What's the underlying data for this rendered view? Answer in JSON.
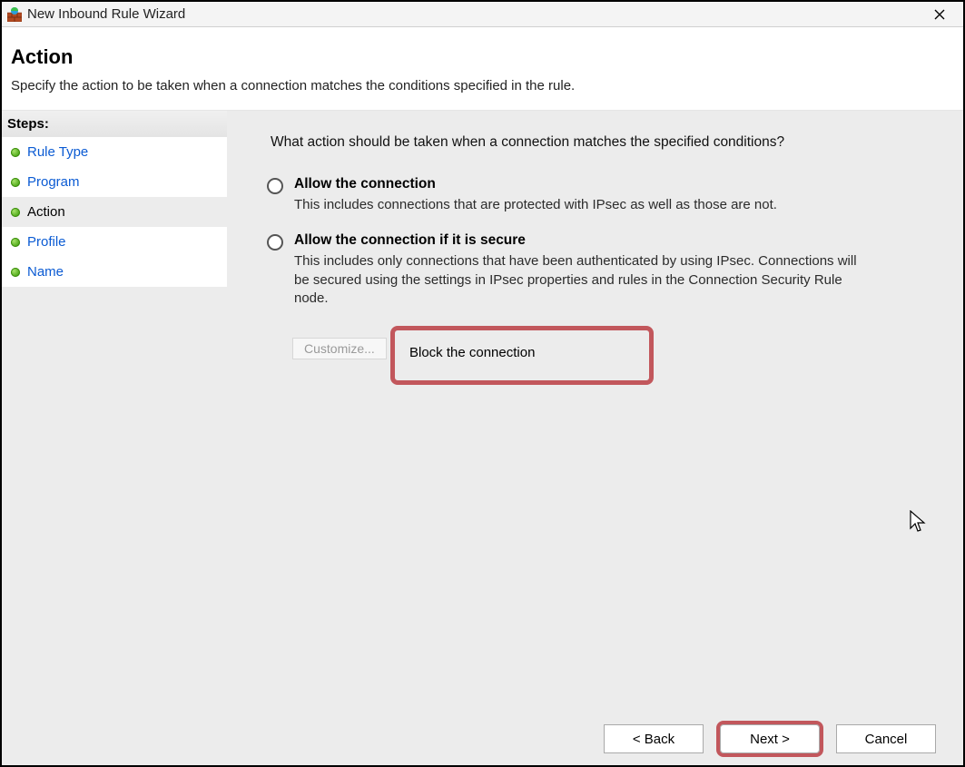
{
  "window": {
    "title": "New Inbound Rule Wizard"
  },
  "header": {
    "title": "Action",
    "subtitle": "Specify the action to be taken when a connection matches the conditions specified in the rule."
  },
  "sidebar": {
    "heading": "Steps:",
    "items": [
      {
        "label": "Rule Type",
        "current": false
      },
      {
        "label": "Program",
        "current": false
      },
      {
        "label": "Action",
        "current": true
      },
      {
        "label": "Profile",
        "current": false
      },
      {
        "label": "Name",
        "current": false
      }
    ]
  },
  "main": {
    "prompt": "What action should be taken when a connection matches the specified conditions?",
    "options": [
      {
        "id": "allow",
        "title": "Allow the connection",
        "description": "This includes connections that are protected with IPsec as well as those are not.",
        "checked": false,
        "highlighted": false
      },
      {
        "id": "allow-secure",
        "title": "Allow the connection if it is secure",
        "description": "This includes only connections that have been authenticated by using IPsec.  Connections will be secured using the settings in IPsec properties and rules in the Connection Security Rule node.",
        "checked": false,
        "highlighted": false,
        "customize_label": "Customize..."
      },
      {
        "id": "block",
        "title": "Block the connection",
        "description": "",
        "checked": true,
        "highlighted": true
      }
    ]
  },
  "footer": {
    "back": "< Back",
    "next": "Next >",
    "cancel": "Cancel",
    "next_highlighted": true
  }
}
